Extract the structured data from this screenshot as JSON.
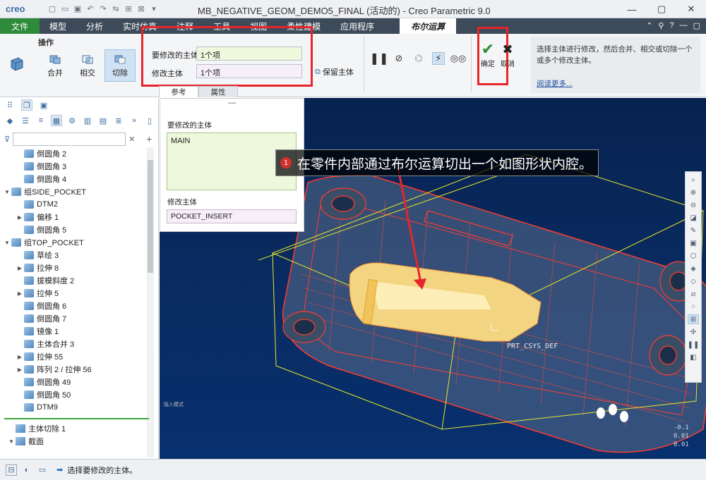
{
  "app": {
    "logo": "creo",
    "window_title": "MB_NEGATIVE_GEOM_DEMO5_FINAL (活动的) - Creo Parametric 9.0"
  },
  "menu": {
    "file": "文件",
    "tabs": [
      "模型",
      "分析",
      "实时仿真",
      "注释",
      "工具",
      "视图",
      "柔性建模",
      "应用程序"
    ],
    "active_tab": "布尔运算"
  },
  "ribbon": {
    "group_label": "操作",
    "ops": {
      "merge": "合并",
      "intersect": "相交",
      "cut": "切除"
    },
    "fields": {
      "body_to_modify_label": "要修改的主体",
      "body_to_modify_value": "1个项",
      "modifying_body_label": "修改主体",
      "modifying_body_value": "1个项"
    },
    "keep_body": "保留主体",
    "ok": "确定",
    "cancel": "取消",
    "help_text": "选择主体进行修改，然后合并、相交或切除一个或多个修改主体。",
    "help_link": "阅读更多..."
  },
  "subtabs": {
    "references": "参考",
    "properties": "属性"
  },
  "ref_panel": {
    "body_to_modify_label": "要修改的主体",
    "body_to_modify_value": "MAIN",
    "modifying_body_label": "修改主体",
    "modifying_body_value": "POCKET_INSERT"
  },
  "tree": {
    "items": [
      {
        "label": "倒圆角 2",
        "indent": 1,
        "exp": ""
      },
      {
        "label": "倒圆角 3",
        "indent": 1,
        "exp": ""
      },
      {
        "label": "倒圆角 4",
        "indent": 1,
        "exp": ""
      },
      {
        "label": "组SIDE_POCKET",
        "indent": 0,
        "exp": "▼"
      },
      {
        "label": "DTM2",
        "indent": 1,
        "exp": ""
      },
      {
        "label": "偏移 1",
        "indent": 1,
        "exp": "▶"
      },
      {
        "label": "倒圆角 5",
        "indent": 1,
        "exp": ""
      },
      {
        "label": "组TOP_POCKET",
        "indent": 0,
        "exp": "▼"
      },
      {
        "label": "草绘 3",
        "indent": 1,
        "exp": ""
      },
      {
        "label": "拉伸 8",
        "indent": 1,
        "exp": "▶"
      },
      {
        "label": "拔模斜度 2",
        "indent": 1,
        "exp": ""
      },
      {
        "label": "拉伸 5",
        "indent": 1,
        "exp": "▶"
      },
      {
        "label": "倒圆角 6",
        "indent": 1,
        "exp": ""
      },
      {
        "label": "倒圆角 7",
        "indent": 1,
        "exp": ""
      },
      {
        "label": "镜像 1",
        "indent": 1,
        "exp": ""
      },
      {
        "label": "主体合并 3",
        "indent": 1,
        "exp": ""
      },
      {
        "label": "拉伸 55",
        "indent": 1,
        "exp": "▶"
      },
      {
        "label": "阵列 2 / 拉伸 56",
        "indent": 1,
        "exp": "▶"
      },
      {
        "label": "倒圆角 49",
        "indent": 1,
        "exp": ""
      },
      {
        "label": "倒圆角 50",
        "indent": 1,
        "exp": ""
      },
      {
        "label": "DTM9",
        "indent": 1,
        "exp": ""
      }
    ],
    "bottom_items": [
      {
        "label": "主体切除 1",
        "exp": ""
      },
      {
        "label": "截面",
        "exp": "▼"
      }
    ]
  },
  "status": {
    "message": "选择要修改的主体。"
  },
  "viewport": {
    "annotation_number": "1",
    "annotation": "在零件内部通过布尔运算切出一个如图形状内腔。",
    "csys_label": "PRT_CSYS_DEF",
    "view_mode": "隐入模式"
  },
  "colors": {
    "accent_red": "#e8242a",
    "file_green": "#2e8b3a",
    "menu_bg": "#3c4a59"
  }
}
